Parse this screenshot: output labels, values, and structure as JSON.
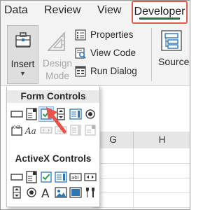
{
  "tabs": {
    "data": "Data",
    "review": "Review",
    "view": "View",
    "developer": "Developer"
  },
  "ribbon": {
    "insert_label": "Insert",
    "design_mode_label_line1": "Design",
    "design_mode_label_line2": "Mode",
    "properties_label": "Properties",
    "view_code_label": "View Code",
    "run_dialog_label": "Run Dialog",
    "source_label": "Source"
  },
  "dropdown": {
    "form_controls_title": "Form Controls",
    "activex_controls_title": "ActiveX Controls",
    "form_controls": [
      "button-icon",
      "combo-box-icon",
      "check-box-icon",
      "spin-button-icon",
      "list-box-icon",
      "option-button-icon",
      "group-box-icon",
      "label-icon",
      "scroll-bar-icon",
      "text-field-icon",
      "combo-list-icon",
      "combo-dropdown-icon"
    ],
    "activex_controls": [
      "command-button-icon",
      "combo-box-icon",
      "check-box-icon",
      "list-box-icon",
      "text-box-icon",
      "scroll-bar-icon",
      "spin-button-icon",
      "option-button-icon",
      "label-icon",
      "image-icon",
      "toggle-button-icon",
      "more-controls-icon"
    ]
  },
  "sheet": {
    "columns": [
      "G",
      "H"
    ]
  },
  "colors": {
    "highlight_border": "#e15c4e",
    "accent_green": "#217346",
    "annotation_arrow": "#e8534a"
  }
}
